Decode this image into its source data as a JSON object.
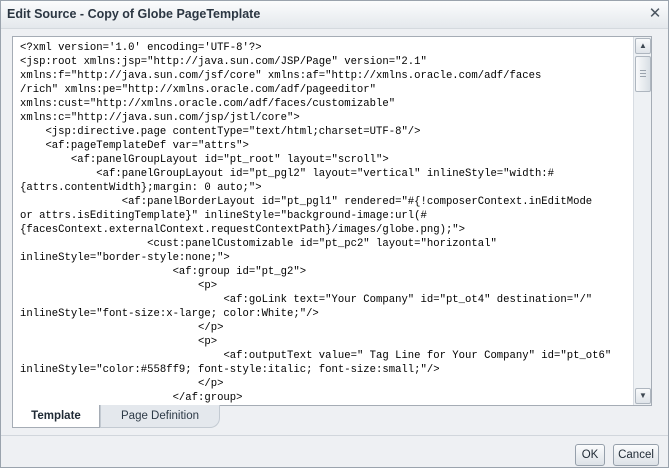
{
  "dialog": {
    "title": "Edit Source - Copy of Globe PageTemplate",
    "close_glyph": "✕"
  },
  "editor": {
    "source": "<?xml version='1.0' encoding='UTF-8'?>\n<jsp:root xmlns:jsp=\"http://java.sun.com/JSP/Page\" version=\"2.1\"\nxmlns:f=\"http://java.sun.com/jsf/core\" xmlns:af=\"http://xmlns.oracle.com/adf/faces\n/rich\" xmlns:pe=\"http://xmlns.oracle.com/adf/pageeditor\"\nxmlns:cust=\"http://xmlns.oracle.com/adf/faces/customizable\"\nxmlns:c=\"http://java.sun.com/jsp/jstl/core\">\n    <jsp:directive.page contentType=\"text/html;charset=UTF-8\"/>\n    <af:pageTemplateDef var=\"attrs\">\n        <af:panelGroupLayout id=\"pt_root\" layout=\"scroll\">\n            <af:panelGroupLayout id=\"pt_pgl2\" layout=\"vertical\" inlineStyle=\"width:#\n{attrs.contentWidth};margin: 0 auto;\">\n                <af:panelBorderLayout id=\"pt_pgl1\" rendered=\"#{!composerContext.inEditMode\nor attrs.isEditingTemplate}\" inlineStyle=\"background-image:url(#\n{facesContext.externalContext.requestContextPath}/images/globe.png);\">\n                    <cust:panelCustomizable id=\"pt_pc2\" layout=\"horizontal\"\ninlineStyle=\"border-style:none;\">\n                        <af:group id=\"pt_g2\">\n                            <p>\n                                <af:goLink text=\"Your Company\" id=\"pt_ot4\" destination=\"/\"\ninlineStyle=\"font-size:x-large; color:White;\"/>\n                            </p>\n                            <p>\n                                <af:outputText value=\" Tag Line for Your Company\" id=\"pt_ot6\"\ninlineStyle=\"color:#558ff9; font-style:italic; font-size:small;\"/>\n                            </p>\n                        </af:group>",
    "scroll_up_glyph": "▲",
    "scroll_down_glyph": "▼"
  },
  "tabs": [
    {
      "label": "Template",
      "selected": true
    },
    {
      "label": "Page Definition",
      "selected": false
    }
  ],
  "buttons": {
    "ok_label": "OK",
    "cancel_label": "Cancel"
  }
}
